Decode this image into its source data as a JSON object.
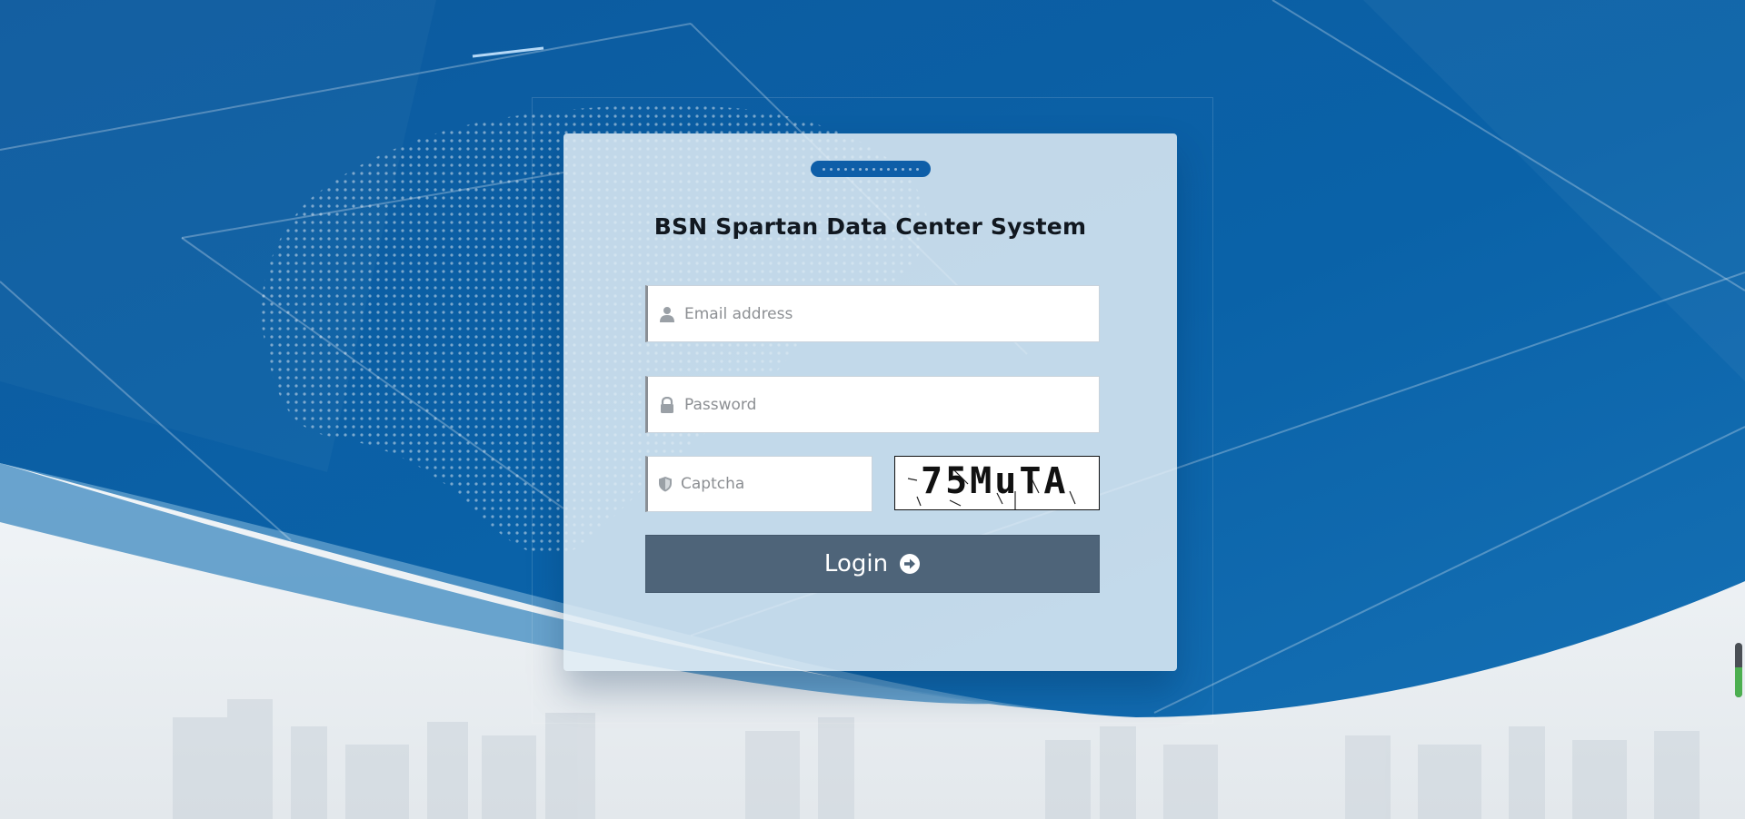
{
  "page": {
    "title": "BSN Spartan Data Center System"
  },
  "form": {
    "email_placeholder": "Email address",
    "password_placeholder": "Password",
    "captcha_placeholder": "Captcha",
    "captcha_image_text": "75MuTA",
    "login_label": "Login"
  },
  "icons": {
    "email": "user-icon",
    "password": "lock-icon",
    "captcha": "shield-icon",
    "login": "arrow-circle-right-icon"
  },
  "colors": {
    "background_blue": "#0a5fa3",
    "wave_light_blue": "#4f92c4",
    "login_button": "#4e6479",
    "card": "#e1ecf5",
    "handle": "#0e5ea8"
  }
}
